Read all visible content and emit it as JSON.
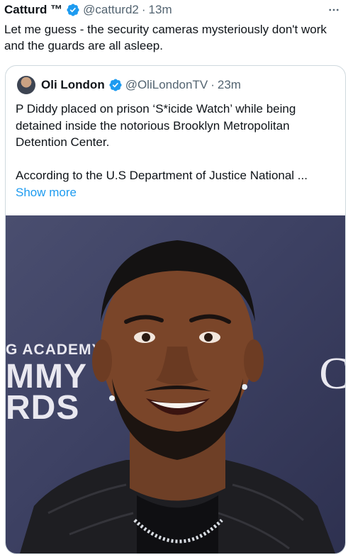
{
  "tweet": {
    "author_name": "Catturd ™",
    "handle": "@catturd2",
    "separator": "·",
    "time": "13m",
    "text": "Let me guess - the security cameras mysteriously don't work and the guards are all asleep."
  },
  "quote": {
    "author_name": "Oli London",
    "handle": "@OliLondonTV",
    "separator": "·",
    "time": "23m",
    "paragraph1": "P Diddy placed on prison ‘S*icide Watch’ while being detained inside the notorious Brooklyn Metropolitan Detention Center.",
    "paragraph2": "According to the U.S Department of Justice National ...",
    "show_more": "Show more",
    "photo_text": {
      "line1": "G ACADEMY",
      "line2": "MMY",
      "line3": "RDS",
      "right_letter": "C"
    }
  },
  "icons": {
    "verified": "verified-badge-icon",
    "more": "more-horizontal-icon"
  },
  "colors": {
    "verified": "#1d9bf0",
    "link": "#1d9bf0",
    "secondary_text": "#536471",
    "border": "#cfd9de"
  }
}
